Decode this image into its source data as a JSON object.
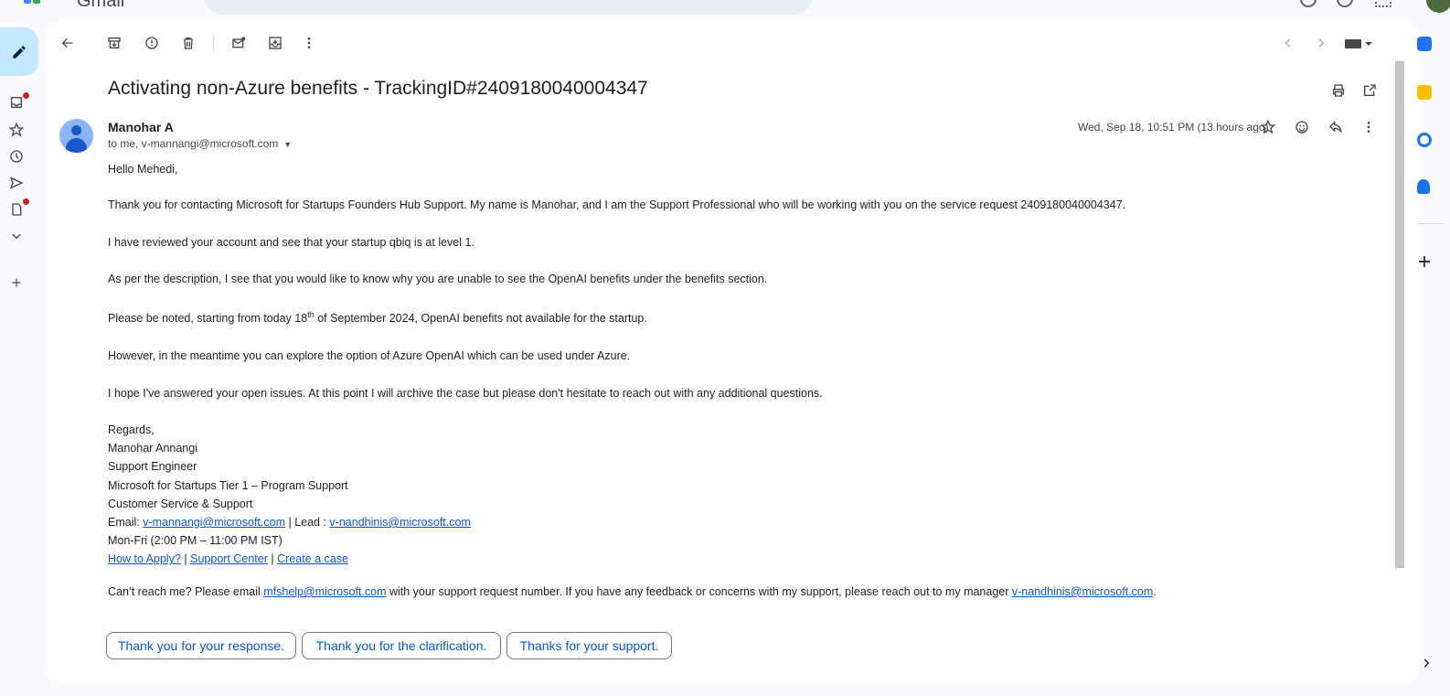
{
  "app": {
    "name": "Gmail"
  },
  "colors": {
    "accent": "#0b57d0",
    "link": "#1155cc",
    "compose_bg": "#c2e7ff",
    "notification_dot": "#c5221f"
  },
  "toolbar": {
    "icons": [
      "back-arrow-icon",
      "archive-icon",
      "report-spam-icon",
      "delete-icon",
      "mark-unread-icon",
      "move-to-icon",
      "more-vert-icon"
    ],
    "right_icons": [
      "chevron-left-icon",
      "chevron-right-icon",
      "keyboard-icon"
    ]
  },
  "email": {
    "subject": "Activating non-Azure benefits - TrackingID#2409180040004347",
    "sender": "Manohar A",
    "recipients": "to me, v-mannangi@microsoft.com",
    "date": "Wed, Sep 18, 10:51 PM (13 hours ago)",
    "greeting": "Hello Mehedi,",
    "p1": "Thank you for contacting Microsoft for Startups Founders Hub Support. My name is Manohar, and I am the Support Professional who will be working with you on the service request 2409180040004347.",
    "p2": "I have reviewed your account and see that your startup qbiq is at level 1.",
    "p3": "As per the description, I see that you would like to know why you are unable to see the OpenAI benefits under the benefits section.",
    "p4_before": "Please be noted, starting from today 18",
    "p4_sup": "th",
    "p4_after": " of September 2024, OpenAI benefits not available for the startup.",
    "p5": "However, in the meantime you can explore the option of Azure OpenAI which can be used under Azure.",
    "p6": "I hope I've answered your open issues. At this point I will archive the case but please don't hesitate to reach out with any additional questions.",
    "signature": {
      "regards": "Regards,",
      "name": "Manohar Annangi",
      "title": "Support Engineer",
      "team": "Microsoft for Startups Tier 1 – Program Support",
      "dept": "Customer Service & Support",
      "email_label": "Email: ",
      "email": "v-mannangi@microsoft.com",
      "lead_label": " | Lead : ",
      "lead_email": "v-nandhinis@microsoft.com",
      "hours": "Mon-Fri (2:00 PM – 11:00 PM IST)",
      "link1": "How to Apply?",
      "sep": " | ",
      "link2": "Support Center",
      "link3": "Create a case"
    },
    "footer_before": "Can’t reach me? Please email ",
    "footer_email": "mfshelp@microsoft.com",
    "footer_middle": " with your support request number. If you have any feedback or concerns with my support, please reach out to my manager ",
    "footer_manager": "v-nandhinis@microsoft.com",
    "footer_end": "."
  },
  "smart_replies": [
    "Thank you for your response.",
    "Thank you for the clarification.",
    "Thanks for your support."
  ]
}
